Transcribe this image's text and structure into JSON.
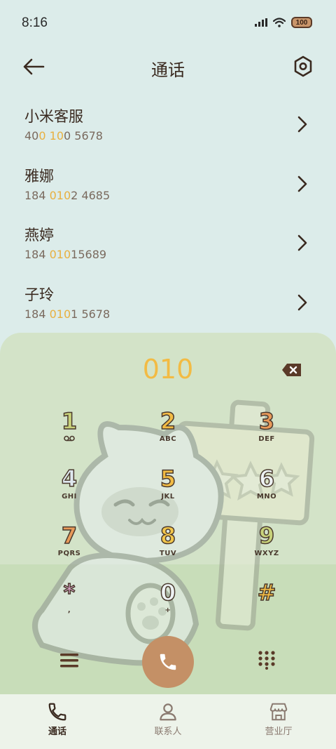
{
  "status_bar": {
    "time": "8:16",
    "battery": "100"
  },
  "header": {
    "title": "通话"
  },
  "contacts": [
    {
      "name": "小米客服",
      "number_parts": [
        "40",
        "0",
        " ",
        "10",
        "0 5678"
      ]
    },
    {
      "name": "雅娜",
      "number_parts": [
        "184 ",
        "010",
        "2 4685",
        "",
        ""
      ]
    },
    {
      "name": "燕婷",
      "number_parts": [
        "184 ",
        "010",
        "15689",
        "",
        ""
      ]
    },
    {
      "name": "子玲",
      "number_parts": [
        "184 ",
        "010",
        "1 5678",
        "",
        ""
      ]
    }
  ],
  "dialer": {
    "input": "010",
    "keys": [
      {
        "digit": "1",
        "letters": "",
        "color": "#c8d27a"
      },
      {
        "digit": "2",
        "letters": "ABC",
        "color": "#f2bb44"
      },
      {
        "digit": "3",
        "letters": "DEF",
        "color": "#e89a5a"
      },
      {
        "digit": "4",
        "letters": "GHI",
        "color": "#dfe8ef"
      },
      {
        "digit": "5",
        "letters": "JKL",
        "color": "#f2bb44"
      },
      {
        "digit": "6",
        "letters": "MNO",
        "color": "#eef2f4"
      },
      {
        "digit": "7",
        "letters": "PQRS",
        "color": "#e89a5a"
      },
      {
        "digit": "8",
        "letters": "TUV",
        "color": "#f2c64c"
      },
      {
        "digit": "9",
        "letters": "WXYZ",
        "color": "#c8d27a"
      },
      {
        "digit": "*",
        "letters": ",",
        "color": "#e8b0d8"
      },
      {
        "digit": "0",
        "letters": "+",
        "color": "#eef2f4"
      },
      {
        "digit": "#",
        "letters": "",
        "color": "#f2bb44"
      }
    ]
  },
  "bottom_nav": {
    "items": [
      {
        "label": "通话",
        "active": true
      },
      {
        "label": "联系人",
        "active": false
      },
      {
        "label": "营业厅",
        "active": false
      }
    ]
  },
  "colors": {
    "accent": "#f2bb44",
    "call_button": "#c49066",
    "brown": "#4a3a2e"
  }
}
